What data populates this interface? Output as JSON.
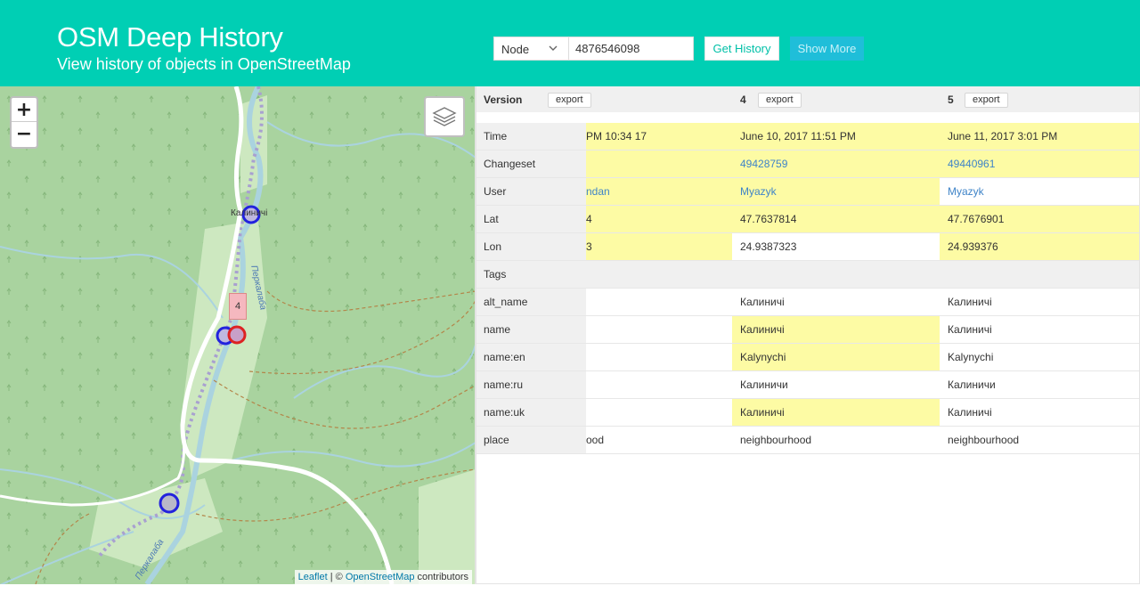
{
  "header": {
    "title": "OSM Deep History",
    "subtitle": "View history of objects in OpenStreetMap",
    "type_value": "Node",
    "id_value": "4876546098",
    "get_history_label": "Get History",
    "show_more_label": "Show More"
  },
  "map": {
    "zoom_in": "+",
    "zoom_out": "−",
    "place_label": "Калиничі",
    "river_label": "Перкалаба",
    "river_label_2": "Перкалаба",
    "version_pin": "4",
    "attribution": {
      "leaflet": "Leaflet",
      "separator": " | © ",
      "osm": "OpenStreetMap",
      "suffix": " contributors"
    }
  },
  "table": {
    "header_label": "Version",
    "export_label": "export",
    "versions": [
      "",
      "4",
      "5"
    ],
    "rows": [
      {
        "label": "Time",
        "values": [
          "17 10:34 PM",
          "June 10, 2017 11:51 PM",
          "June 11, 2017 3:01 PM"
        ],
        "highlight": [
          true,
          true,
          true
        ],
        "links": [
          false,
          false,
          false
        ]
      },
      {
        "label": "Changeset",
        "values": [
          "",
          "49428759",
          "49440961"
        ],
        "highlight": [
          true,
          true,
          true
        ],
        "links": [
          true,
          true,
          true
        ]
      },
      {
        "label": "User",
        "values": [
          "ndan",
          "Myazyk",
          "Myazyk"
        ],
        "highlight": [
          true,
          true,
          false
        ],
        "links": [
          true,
          true,
          true
        ]
      },
      {
        "label": "Lat",
        "values": [
          "4",
          "47.7637814",
          "47.7676901"
        ],
        "highlight": [
          true,
          true,
          true
        ],
        "links": [
          false,
          false,
          false
        ]
      },
      {
        "label": "Lon",
        "values": [
          "3",
          "24.9387323",
          "24.939376"
        ],
        "highlight": [
          true,
          false,
          true
        ],
        "links": [
          false,
          false,
          false
        ]
      }
    ],
    "tags_label": "Tags",
    "tag_rows": [
      {
        "label": "alt_name",
        "values": [
          "",
          "Калиничі",
          "Калиничі"
        ],
        "highlight": [
          false,
          false,
          false
        ]
      },
      {
        "label": "name",
        "values": [
          "",
          "Калиничі",
          "Калиничі"
        ],
        "highlight": [
          false,
          true,
          false
        ]
      },
      {
        "label": "name:en",
        "values": [
          "",
          "Kalynychi",
          "Kalynychi"
        ],
        "highlight": [
          false,
          true,
          false
        ]
      },
      {
        "label": "name:ru",
        "values": [
          "",
          "Калиничи",
          "Калиничи"
        ],
        "highlight": [
          false,
          false,
          false
        ]
      },
      {
        "label": "name:uk",
        "values": [
          "",
          "Калиничі",
          "Калиничі"
        ],
        "highlight": [
          false,
          true,
          false
        ]
      },
      {
        "label": "place",
        "values": [
          "ood",
          "neighbourhood",
          "neighbourhood"
        ],
        "highlight": [
          false,
          false,
          false
        ]
      }
    ]
  },
  "colors": {
    "header_bg": "#00cfb4",
    "highlight": "#fdfba4",
    "link": "#3f84c8",
    "marker_blue": "#2222dd",
    "marker_red": "#dd2222"
  }
}
